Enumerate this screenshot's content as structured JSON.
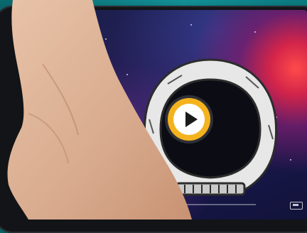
{
  "screen": {
    "content": "astronaut-helmet-video-frame",
    "video_state": "paused"
  },
  "controls": {
    "play_icon": "play-icon",
    "fullscreen_icon": "fullscreen-icon",
    "progress": 0.0
  },
  "colors": {
    "accent": "#f4b31e",
    "frame": "#0f7c82",
    "phone": "#121417"
  }
}
